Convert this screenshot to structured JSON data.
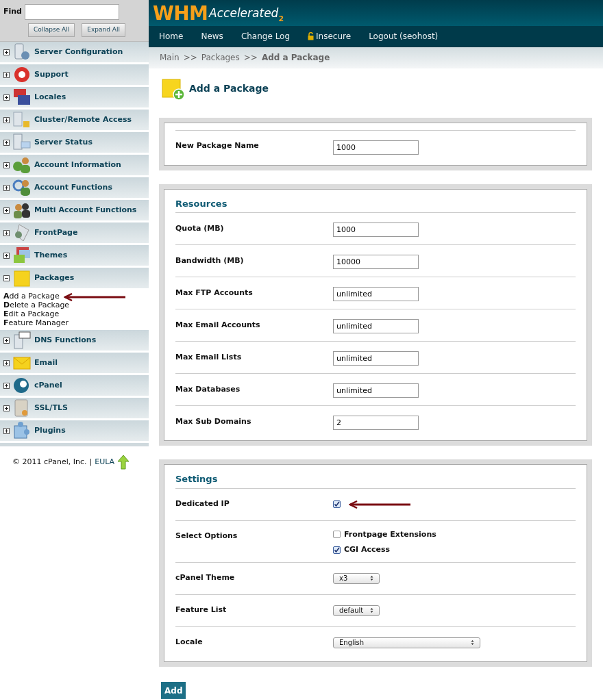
{
  "find": {
    "label": "Find",
    "buttons": [
      "Collapse All",
      "Expand All"
    ]
  },
  "sidebar": {
    "items": [
      {
        "label": "Server Configuration",
        "expanded": false
      },
      {
        "label": "Support",
        "expanded": false
      },
      {
        "label": "Locales",
        "expanded": false
      },
      {
        "label": "Cluster/Remote Access",
        "expanded": false
      },
      {
        "label": "Server Status",
        "expanded": false
      },
      {
        "label": "Account Information",
        "expanded": false
      },
      {
        "label": "Account Functions",
        "expanded": false
      },
      {
        "label": "Multi Account Functions",
        "expanded": false
      },
      {
        "label": "FrontPage",
        "expanded": false
      },
      {
        "label": "Themes",
        "expanded": false
      },
      {
        "label": "Packages",
        "expanded": true,
        "children": [
          {
            "label": "**A**dd a Package",
            "pointed": true
          },
          {
            "label": "**D**elete a Package",
            "pointed": false
          },
          {
            "label": "**E**dit a Package",
            "pointed": false
          },
          {
            "label": "**F**eature Manager",
            "pointed": false
          }
        ]
      },
      {
        "label": "DNS Functions",
        "expanded": false
      },
      {
        "label": "Email",
        "expanded": false
      },
      {
        "label": "cPanel",
        "expanded": false
      },
      {
        "label": "SSL/TLS",
        "expanded": false
      },
      {
        "label": "Plugins",
        "expanded": false
      }
    ]
  },
  "footer": {
    "copyright": "© 2011 cPanel, Inc.",
    "separator": "|",
    "link": "EULA"
  },
  "logo": {
    "main": "WHM",
    "sub": "Accelerated",
    "version": "2"
  },
  "nav": [
    {
      "label": "Home",
      "kind": "link"
    },
    {
      "label": "News",
      "kind": "link"
    },
    {
      "label": "Change Log",
      "kind": "link"
    },
    {
      "label": "Insecure",
      "kind": "lock"
    },
    {
      "label": "Logout (seohost)",
      "kind": "link"
    }
  ],
  "breadcrumb": [
    {
      "label": "Main",
      "kind": "link",
      "current": false
    },
    {
      "label": ">>",
      "kind": "sep"
    },
    {
      "label": "Packages",
      "kind": "link",
      "current": false
    },
    {
      "label": ">>",
      "kind": "sep"
    },
    {
      "label": "Add a Package",
      "kind": "link",
      "current": true
    }
  ],
  "page_title": "Add a Package",
  "sections": [
    {
      "rows": [
        {
          "kind": "text",
          "label": "New Package Name",
          "value": "1000"
        }
      ]
    },
    {
      "title": "Resources",
      "rows": [
        {
          "kind": "text",
          "label": "Quota (MB)",
          "value": "1000"
        },
        {
          "kind": "text",
          "label": "Bandwidth (MB)",
          "value": "10000"
        },
        {
          "kind": "text",
          "label": "Max FTP Accounts",
          "value": "unlimited"
        },
        {
          "kind": "text",
          "label": "Max Email Accounts",
          "value": "unlimited"
        },
        {
          "kind": "text",
          "label": "Max Email Lists",
          "value": "unlimited"
        },
        {
          "kind": "text",
          "label": "Max Databases",
          "value": "unlimited"
        },
        {
          "kind": "text",
          "label": "Max Sub Domains",
          "value": "2"
        }
      ]
    },
    {
      "title": "Settings",
      "rows": [
        {
          "kind": "checkbox",
          "label": "Dedicated IP",
          "checked": true,
          "pointed": true
        },
        {
          "kind": "options",
          "label": "Select Options",
          "options": [
            {
              "label": "Frontpage Extensions",
              "checked": false
            },
            {
              "label": "CGI Access",
              "checked": true
            }
          ]
        },
        {
          "kind": "select",
          "label": "cPanel Theme",
          "value": "x3"
        },
        {
          "kind": "select",
          "label": "Feature List",
          "value": "default"
        },
        {
          "kind": "wide-select",
          "label": "Locale",
          "value": "English"
        }
      ]
    }
  ],
  "submit": "Add"
}
